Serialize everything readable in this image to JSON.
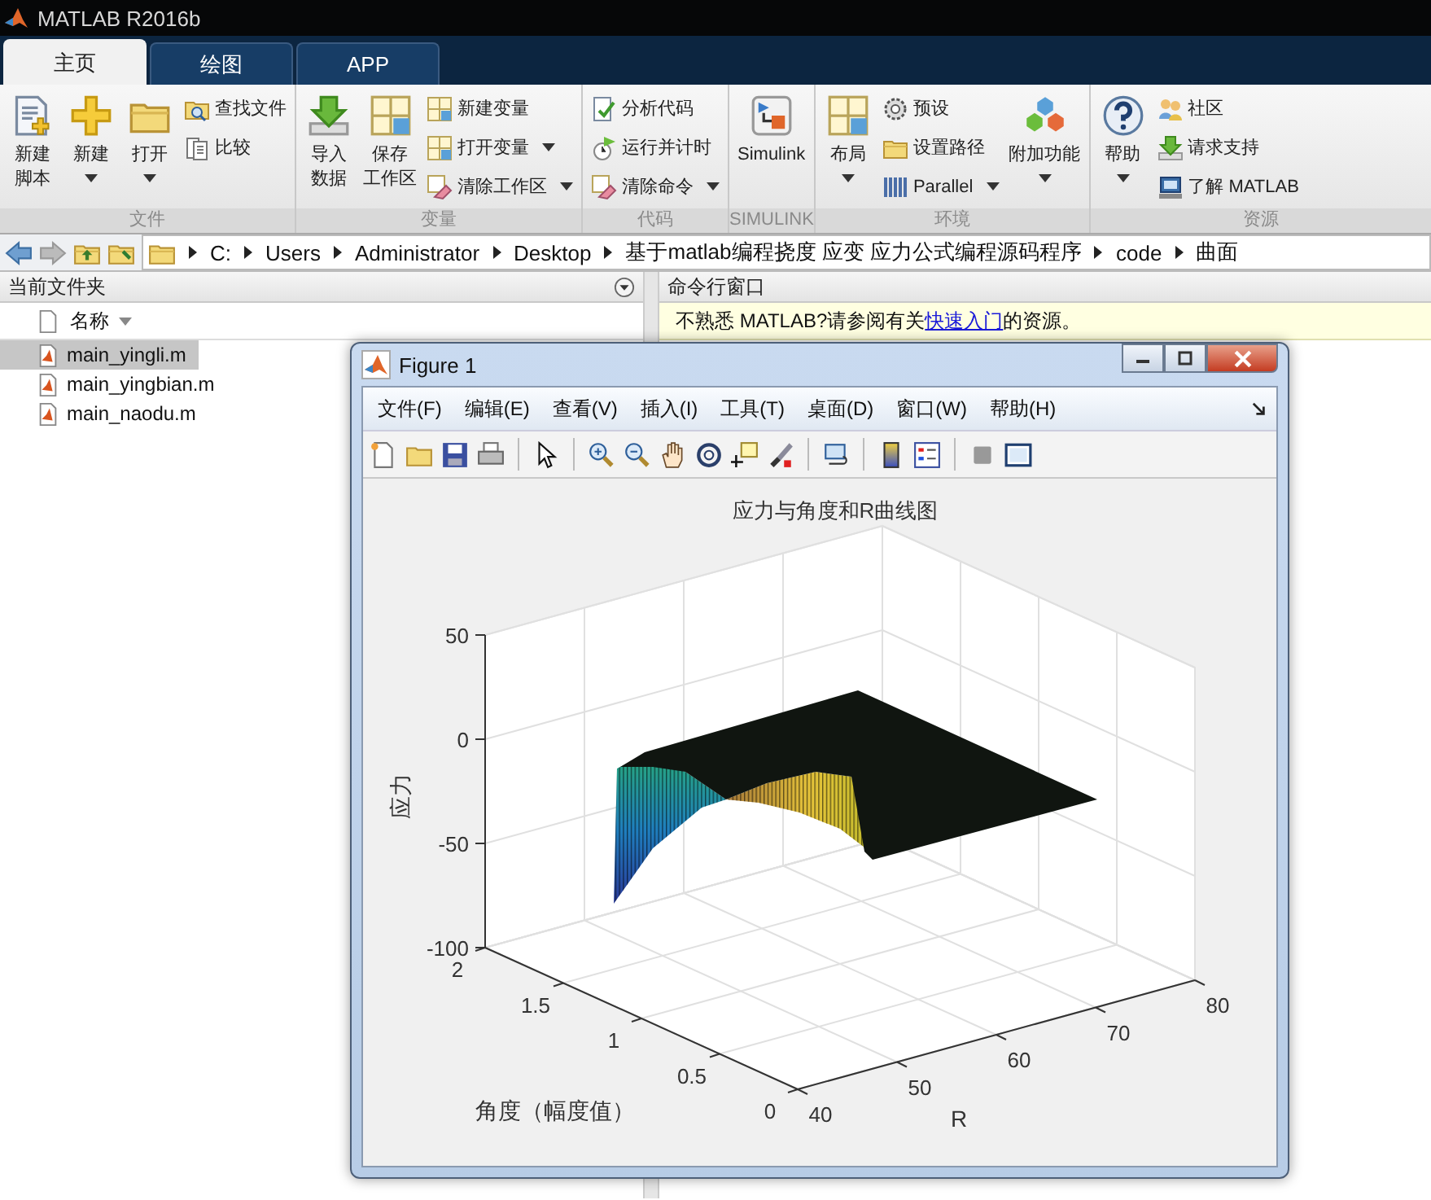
{
  "window": {
    "title": "MATLAB R2016b"
  },
  "tabs": [
    {
      "label": "主页",
      "selected": true
    },
    {
      "label": "绘图",
      "selected": false
    },
    {
      "label": "APP",
      "selected": false
    }
  ],
  "ribbon": [
    {
      "label": "文件",
      "items": [
        {
          "kind": "large",
          "lines": [
            "新建",
            "脚本"
          ],
          "dropdown": false
        },
        {
          "kind": "large",
          "lines": [
            "新建"
          ],
          "dropdown": true
        },
        {
          "kind": "large",
          "lines": [
            "打开"
          ],
          "dropdown": true
        },
        {
          "kind": "stack",
          "items": [
            {
              "label": "查找文件",
              "dropdown": false
            },
            {
              "label": "比较",
              "dropdown": false
            }
          ]
        }
      ]
    },
    {
      "label": "变量",
      "items": [
        {
          "kind": "large",
          "lines": [
            "导入",
            "数据"
          ],
          "dropdown": false
        },
        {
          "kind": "large",
          "lines": [
            "保存",
            "工作区"
          ],
          "dropdown": false
        },
        {
          "kind": "stack",
          "items": [
            {
              "label": "新建变量",
              "dropdown": false
            },
            {
              "label": "打开变量",
              "dropdown": true
            },
            {
              "label": "清除工作区",
              "dropdown": true
            }
          ]
        }
      ]
    },
    {
      "label": "代码",
      "items": [
        {
          "kind": "stack",
          "items": [
            {
              "label": "分析代码",
              "dropdown": false
            },
            {
              "label": "运行并计时",
              "dropdown": false
            },
            {
              "label": "清除命令",
              "dropdown": true
            }
          ]
        }
      ]
    },
    {
      "label": "SIMULINK",
      "items": [
        {
          "kind": "large",
          "lines": [
            "Simulink"
          ],
          "dropdown": false
        }
      ]
    },
    {
      "label": "环境",
      "items": [
        {
          "kind": "large",
          "lines": [
            "布局"
          ],
          "dropdown": true
        },
        {
          "kind": "stack",
          "items": [
            {
              "label": "预设",
              "dropdown": false
            },
            {
              "label": "设置路径",
              "dropdown": false
            },
            {
              "label": "Parallel",
              "dropdown": true
            }
          ]
        },
        {
          "kind": "large",
          "lines": [
            "附加功能"
          ],
          "dropdown": true
        }
      ]
    },
    {
      "label": "资源",
      "items": [
        {
          "kind": "large",
          "lines": [
            "帮助"
          ],
          "dropdown": true
        },
        {
          "kind": "stack",
          "items": [
            {
              "label": "社区",
              "dropdown": false
            },
            {
              "label": "请求支持",
              "dropdown": false
            },
            {
              "label": "了解 MATLAB",
              "dropdown": false
            }
          ]
        }
      ]
    }
  ],
  "path": {
    "crumbs": [
      "C:",
      "Users",
      "Administrator",
      "Desktop",
      "基于matlab编程挠度 应变 应力公式编程源码程序",
      "code",
      "曲面"
    ]
  },
  "current_folder": {
    "title": "当前文件夹",
    "column": "名称",
    "files": [
      {
        "name": "main_yingli.m",
        "selected": true
      },
      {
        "name": "main_yingbian.m",
        "selected": false
      },
      {
        "name": "main_naodu.m",
        "selected": false
      }
    ]
  },
  "command_window": {
    "title": "命令行窗口",
    "notice": {
      "before": "不熟悉 MATLAB?请参阅有关",
      "link": "快速入门",
      "after": "的资源。"
    }
  },
  "figure": {
    "title": "Figure 1",
    "menu": [
      "文件(F)",
      "编辑(E)",
      "查看(V)",
      "插入(I)",
      "工具(T)",
      "桌面(D)",
      "窗口(W)",
      "帮助(H)"
    ],
    "plot": {
      "title": "应力与角度和R曲线图",
      "z_label": "应力",
      "angle_label": "角度（幅度值）",
      "r_label": "R",
      "z_ticks": [
        "50",
        "0",
        "-50",
        "-100"
      ],
      "angle_ticks": [
        "2",
        "1.5",
        "1",
        "0.5",
        "0"
      ],
      "r_ticks": [
        "40",
        "50",
        "60",
        "70",
        "80"
      ]
    }
  }
}
